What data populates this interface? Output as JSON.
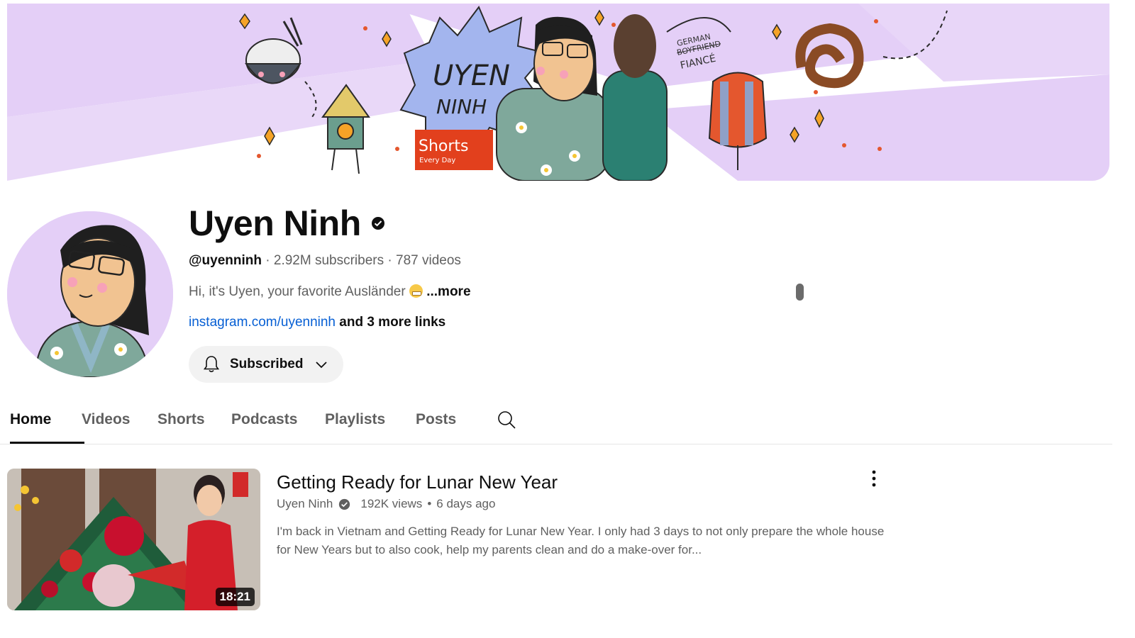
{
  "banner": {
    "title_line1": "UYEN",
    "title_line2": "NINH",
    "shorts_label": "Shorts",
    "shorts_sub": "Every Day",
    "german_label": "GERMAN",
    "boyfriend_label": "BOYFRIEND",
    "fiance_label": "FIANCÉ"
  },
  "channel": {
    "name": "Uyen Ninh",
    "handle": "@uyenninh",
    "subscribers": "2.92M subscribers",
    "videos": "787 videos",
    "separator": "·",
    "description": "Hi, it's Uyen, your favorite Ausländer",
    "more_label": "...more",
    "link": "instagram.com/uyenninh",
    "more_links": "and 3 more links",
    "subscribe_label": "Subscribed"
  },
  "tabs": [
    "Home",
    "Videos",
    "Shorts",
    "Podcasts",
    "Playlists",
    "Posts"
  ],
  "icons": [
    "verified-check-icon",
    "bell-icon",
    "chevron-down-icon",
    "search-icon",
    "more-vert-icon"
  ],
  "video": {
    "title": "Getting Ready for Lunar New Year",
    "channel": "Uyen Ninh",
    "views": "192K views",
    "age": "6 days ago",
    "dot": "•",
    "description": "I'm back in Vietnam and Getting Ready for Lunar New Year. I only had 3 days to not only prepare the whole house for New Years but to also cook, help my parents clean and do a make-over for...",
    "duration": "18:21"
  },
  "colors": {
    "banner_purple": "#e4cff7",
    "link_blue": "#065fd4",
    "text_primary": "#0f0f0f",
    "text_secondary": "#606060",
    "button_bg": "#f2f2f2"
  }
}
